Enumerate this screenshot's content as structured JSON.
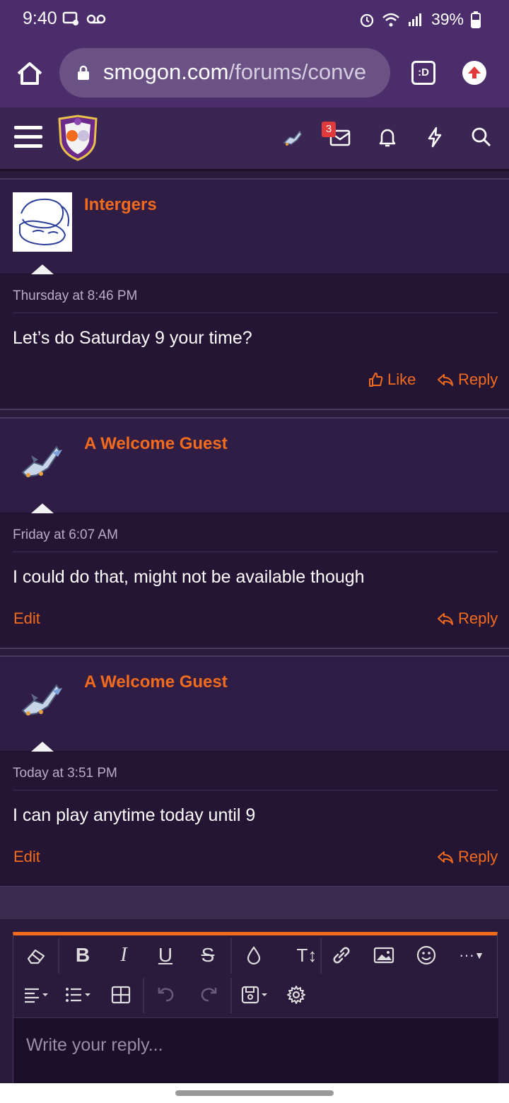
{
  "status_bar": {
    "time": "9:40",
    "battery": "39%"
  },
  "browser": {
    "url_domain": "smogon.com",
    "url_path": "/forums/conve",
    "tabs_label": ":D"
  },
  "header": {
    "notification_count": "3"
  },
  "messages": [
    {
      "username": "Intergers",
      "date": "Thursday at 8:46 PM",
      "text": "Let’s do Saturday 9 your time?",
      "left_action": "Like",
      "right_action": "Reply"
    },
    {
      "username": "A Welcome Guest",
      "date": "Friday at 6:07 AM",
      "text": "I could do that, might not be available though",
      "left_action": "Edit",
      "right_action": "Reply"
    },
    {
      "username": "A Welcome Guest",
      "date": "Today at 3:51 PM",
      "text": "I can play anytime today until 9",
      "left_action": "Edit",
      "right_action": "Reply"
    }
  ],
  "editor": {
    "placeholder": "Write your reply...",
    "bold": "B",
    "italic": "I",
    "underline": "U",
    "strike": "S",
    "text_size": "T↕",
    "more": "···"
  },
  "colors": {
    "accent": "#f26b1d",
    "background": "#2a1a3c",
    "status_bar": "#4a2d6a"
  }
}
